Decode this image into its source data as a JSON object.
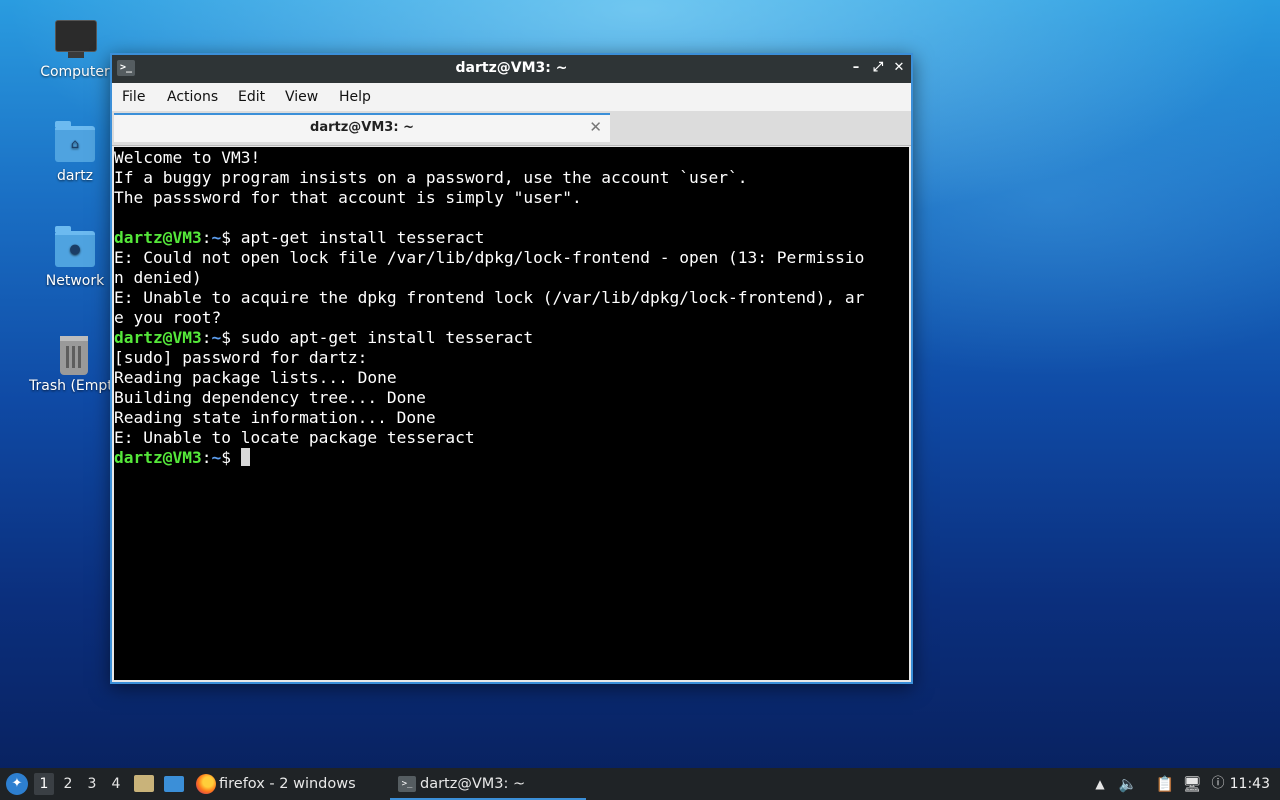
{
  "desktop": {
    "icons": [
      {
        "label": "Computer",
        "icon": "computer-icon"
      },
      {
        "label": "dartz",
        "icon": "home-folder-icon"
      },
      {
        "label": "Network",
        "icon": "network-folder-icon"
      },
      {
        "label": "Trash (Empty)",
        "icon": "trash-icon"
      }
    ]
  },
  "window": {
    "title": "dartz@VM3: ~",
    "controls": {
      "minimize": "–",
      "maximize": "⤢",
      "close": "✕"
    },
    "menu": [
      "File",
      "Actions",
      "Edit",
      "View",
      "Help"
    ],
    "tab": {
      "label": "dartz@VM3: ~",
      "close": "✕"
    }
  },
  "terminal": {
    "prompt": {
      "user": "dartz@VM3",
      "colon": ":",
      "path": "~",
      "symbol": "$ "
    },
    "lines": [
      {
        "text": "Welcome to VM3!"
      },
      {
        "text": "If a buggy program insists on a password, use the account `user`."
      },
      {
        "text": "The passsword for that account is simply \"user\"."
      },
      {
        "text": ""
      },
      {
        "prompt": true,
        "text": "apt-get install tesseract"
      },
      {
        "text": "E: Could not open lock file /var/lib/dpkg/lock-frontend - open (13: Permissio"
      },
      {
        "text": "n denied)"
      },
      {
        "text": "E: Unable to acquire the dpkg frontend lock (/var/lib/dpkg/lock-frontend), ar"
      },
      {
        "text": "e you root?"
      },
      {
        "prompt": true,
        "text": "sudo apt-get install tesseract"
      },
      {
        "text": "[sudo] password for dartz:"
      },
      {
        "text": "Reading package lists... Done"
      },
      {
        "text": "Building dependency tree... Done"
      },
      {
        "text": "Reading state information... Done"
      },
      {
        "text": "E: Unable to locate package tesseract"
      },
      {
        "prompt": true,
        "text": "",
        "cursor": true
      }
    ]
  },
  "taskbar": {
    "workspaces": [
      "1",
      "2",
      "3",
      "4"
    ],
    "active_workspace": "1",
    "tasks": [
      {
        "label": "firefox - 2 windows",
        "icon": "firefox-icon"
      },
      {
        "label": "dartz@VM3: ~",
        "icon": "terminal-icon"
      }
    ],
    "clock": "11:43",
    "tray_icons": [
      "eject-icon",
      "volume-icon",
      "clipboard-icon",
      "network-icon",
      "update-icon"
    ]
  }
}
